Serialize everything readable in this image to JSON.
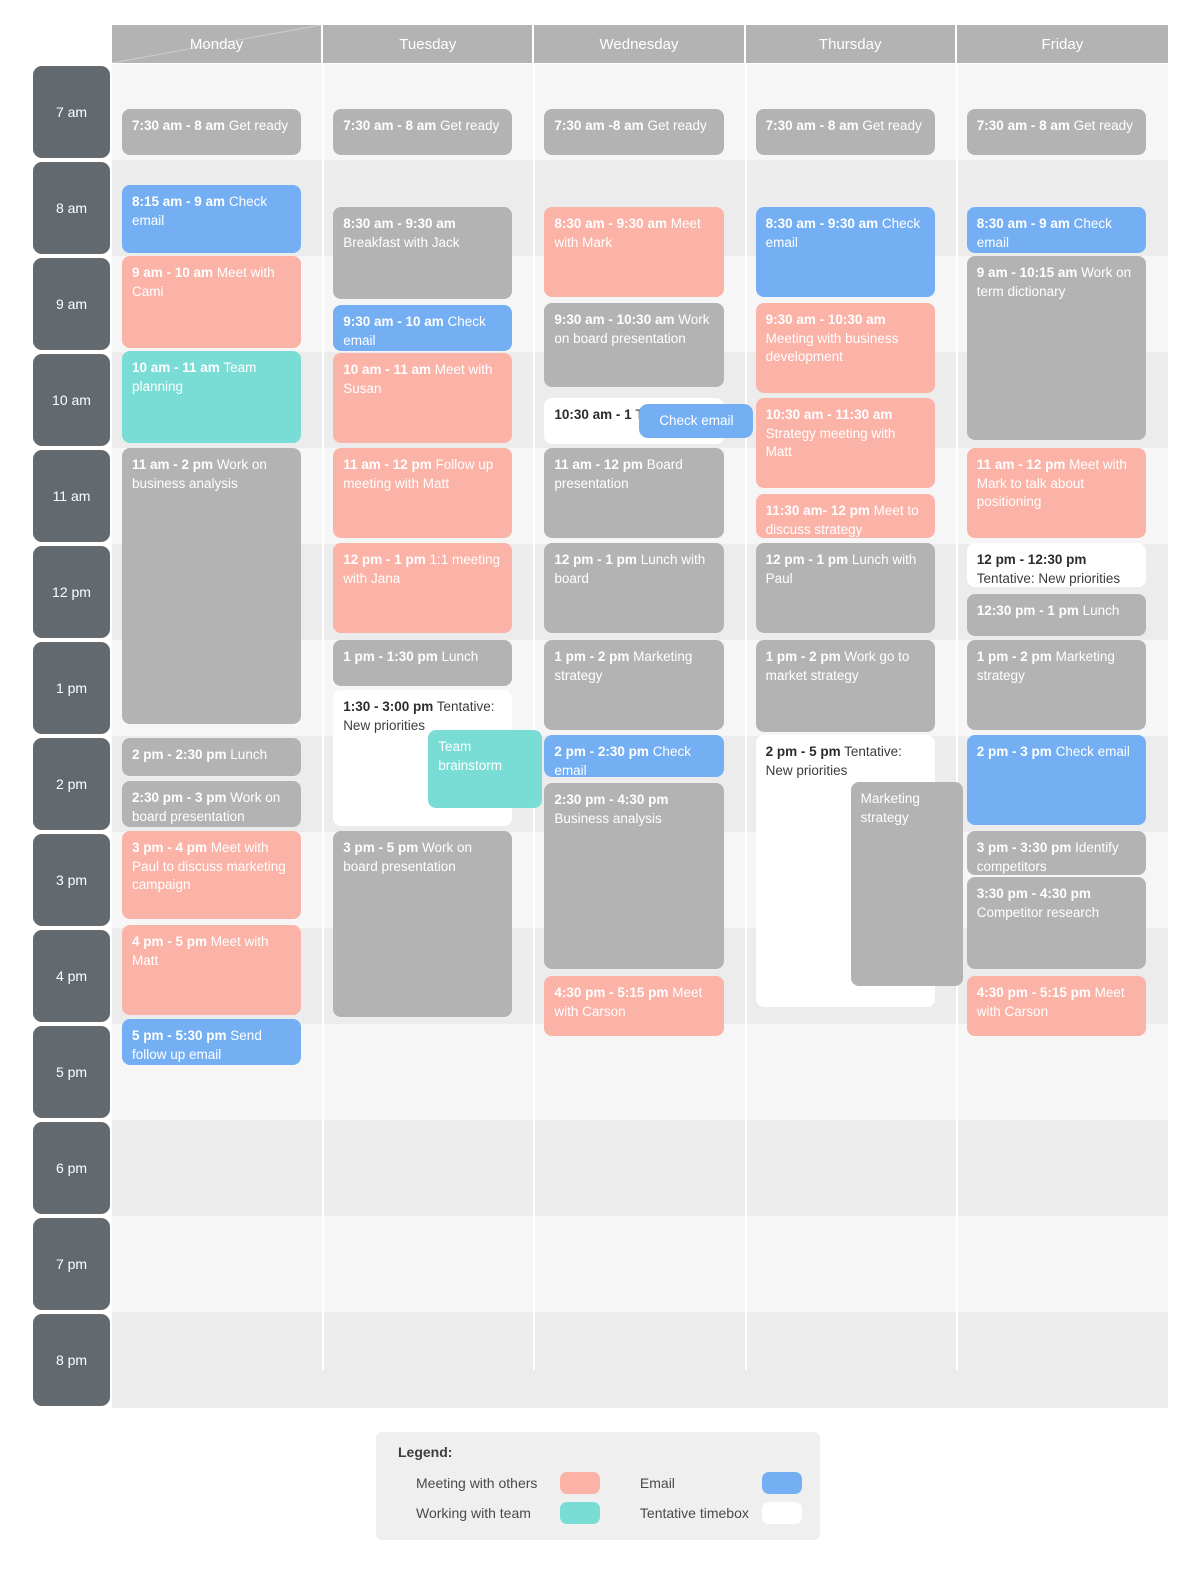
{
  "calendar": {
    "days": [
      "Monday",
      "Tuesday",
      "Wednesday",
      "Thursday",
      "Friday"
    ],
    "hours": [
      "7 am",
      "8 am",
      "9 am",
      "10 am",
      "11 am",
      "12 pm",
      "1 pm",
      "2 pm",
      "3 pm",
      "4 pm",
      "5 pm",
      "6 pm",
      "7 pm",
      "8 pm"
    ],
    "colors": {
      "meeting_with_others": "#fbb2a7",
      "working_with_team": "#79dcd5",
      "email": "#74aff4",
      "tentative_timebox": "#ffffff",
      "default_event": "#b3b3b3",
      "hour_gutter": "#62696f",
      "day_header": "#b3b3b3"
    },
    "events": [
      {
        "id": "mon-0730",
        "day": "Monday",
        "time": "7:30 am - 8 am",
        "title": "Get ready",
        "category": "default"
      },
      {
        "id": "mon-0815",
        "day": "Monday",
        "time": "8:15 am - 9 am",
        "title": "Check email",
        "category": "email"
      },
      {
        "id": "mon-0900",
        "day": "Monday",
        "time": "9 am - 10 am",
        "title": "Meet with Cami",
        "category": "meeting"
      },
      {
        "id": "mon-1000",
        "day": "Monday",
        "time": "10 am - 11 am",
        "title": "Team planning",
        "category": "team"
      },
      {
        "id": "mon-1100",
        "day": "Monday",
        "time": "11 am - 2 pm",
        "title": "Work on business analysis",
        "category": "default"
      },
      {
        "id": "mon-1400",
        "day": "Monday",
        "time": "2 pm - 2:30 pm",
        "title": "Lunch",
        "category": "default"
      },
      {
        "id": "mon-1430",
        "day": "Monday",
        "time": "2:30 pm - 3 pm",
        "title": "Work on board presentation",
        "category": "default"
      },
      {
        "id": "mon-1500",
        "day": "Monday",
        "time": "3 pm - 4 pm",
        "title": "Meet with Paul to discuss marketing campaign",
        "category": "meeting"
      },
      {
        "id": "mon-1600",
        "day": "Monday",
        "time": "4 pm - 5 pm",
        "title": "Meet with Matt",
        "category": "meeting"
      },
      {
        "id": "mon-1700",
        "day": "Monday",
        "time": "5 pm - 5:30 pm",
        "title": "Send follow up email",
        "category": "email"
      },
      {
        "id": "tue-0730",
        "day": "Tuesday",
        "time": "7:30 am - 8 am",
        "title": "Get ready",
        "category": "default"
      },
      {
        "id": "tue-0830",
        "day": "Tuesday",
        "time": "8:30 am - 9:30 am",
        "title": "Breakfast with Jack",
        "category": "default"
      },
      {
        "id": "tue-0930",
        "day": "Tuesday",
        "time": "9:30 am - 10 am",
        "title": "Check email",
        "category": "email"
      },
      {
        "id": "tue-1000",
        "day": "Tuesday",
        "time": "10 am - 11 am",
        "title": "Meet with Susan",
        "category": "meeting"
      },
      {
        "id": "tue-1100",
        "day": "Tuesday",
        "time": "11 am - 12 pm",
        "title": "Follow up meeting with Matt",
        "category": "meeting"
      },
      {
        "id": "tue-1200",
        "day": "Tuesday",
        "time": "12 pm - 1 pm",
        "title": "1:1 meeting with Jana",
        "category": "meeting"
      },
      {
        "id": "tue-1300",
        "day": "Tuesday",
        "time": "1 pm - 1:30 pm",
        "title": "Lunch",
        "category": "default"
      },
      {
        "id": "tue-1330",
        "day": "Tuesday",
        "time": "1:30 - 3:00 pm",
        "title": "Tentative: New priorities",
        "category": "tentative"
      },
      {
        "id": "tue-brainstorm",
        "day": "Tuesday",
        "time": "",
        "title": "Team brainstorm",
        "category": "team"
      },
      {
        "id": "tue-1500",
        "day": "Tuesday",
        "time": "3 pm - 5 pm",
        "title": "Work on board presentation",
        "category": "default"
      },
      {
        "id": "wed-0730",
        "day": "Wednesday",
        "time": "7:30 am -8 am",
        "title": "Get ready",
        "category": "default"
      },
      {
        "id": "wed-0830",
        "day": "Wednesday",
        "time": "8:30 am - 9:30 am",
        "title": "Meet with Mark",
        "category": "meeting"
      },
      {
        "id": "wed-0930",
        "day": "Wednesday",
        "time": "9:30 am - 10:30 am",
        "title": "Work on board presentation",
        "category": "default"
      },
      {
        "id": "wed-1030",
        "day": "Wednesday",
        "time": "10:30 am - 1",
        "title": "Tentative: N",
        "category": "tentative"
      },
      {
        "id": "wed-checkemail",
        "day": "Wednesday",
        "time": "",
        "title": "Check email",
        "category": "email"
      },
      {
        "id": "wed-1100",
        "day": "Wednesday",
        "time": "11 am - 12 pm",
        "title": "Board presentation",
        "category": "default"
      },
      {
        "id": "wed-1200",
        "day": "Wednesday",
        "time": "12 pm - 1 pm",
        "title": "Lunch with board",
        "category": "default"
      },
      {
        "id": "wed-1300",
        "day": "Wednesday",
        "time": "1 pm - 2 pm",
        "title": "Marketing strategy",
        "category": "default"
      },
      {
        "id": "wed-1400",
        "day": "Wednesday",
        "time": "2 pm - 2:30 pm",
        "title": "Check email",
        "category": "email"
      },
      {
        "id": "wed-1430",
        "day": "Wednesday",
        "time": "2:30 pm - 4:30 pm",
        "title": "Business analysis",
        "category": "default"
      },
      {
        "id": "wed-1630",
        "day": "Wednesday",
        "time": "4:30 pm - 5:15 pm",
        "title": "Meet with Carson",
        "category": "meeting"
      },
      {
        "id": "thu-0730",
        "day": "Thursday",
        "time": "7:30 am - 8 am",
        "title": "Get ready",
        "category": "default"
      },
      {
        "id": "thu-0830",
        "day": "Thursday",
        "time": "8:30 am - 9:30 am",
        "title": "Check email",
        "category": "email"
      },
      {
        "id": "thu-0930",
        "day": "Thursday",
        "time": "9:30 am  - 10:30 am",
        "title": "Meeting with business development",
        "category": "meeting"
      },
      {
        "id": "thu-1030",
        "day": "Thursday",
        "time": "10:30 am - 11:30 am",
        "title": "Strategy meeting with Matt",
        "category": "meeting"
      },
      {
        "id": "thu-1130",
        "day": "Thursday",
        "time": "11:30 am- 12 pm",
        "title": "Meet to discuss strategy",
        "category": "meeting"
      },
      {
        "id": "thu-1200",
        "day": "Thursday",
        "time": "12 pm - 1 pm",
        "title": "Lunch with Paul",
        "category": "default"
      },
      {
        "id": "thu-1300",
        "day": "Thursday",
        "time": "1 pm - 2 pm",
        "title": "Work go to market strategy",
        "category": "default"
      },
      {
        "id": "thu-1400",
        "day": "Thursday",
        "time": "2 pm  - 5 pm",
        "title": "Tentative: New priorities",
        "category": "tentative"
      },
      {
        "id": "thu-marketing",
        "day": "Thursday",
        "time": "",
        "title": "Marketing strategy",
        "category": "default"
      },
      {
        "id": "fri-0730",
        "day": "Friday",
        "time": "7:30 am - 8 am",
        "title": "Get ready",
        "category": "default"
      },
      {
        "id": "fri-0830",
        "day": "Friday",
        "time": "8:30 am - 9 am",
        "title": "Check email",
        "category": "email"
      },
      {
        "id": "fri-0900",
        "day": "Friday",
        "time": "9 am - 10:15 am",
        "title": "Work on term dictionary",
        "category": "default"
      },
      {
        "id": "fri-1100",
        "day": "Friday",
        "time": "11 am - 12 pm",
        "title": "Meet with Mark to talk about positioning",
        "category": "meeting"
      },
      {
        "id": "fri-1200",
        "day": "Friday",
        "time": "12 pm - 12:30 pm",
        "title": "Tentative: New priorities",
        "category": "tentative"
      },
      {
        "id": "fri-1230",
        "day": "Friday",
        "time": "12:30 pm - 1 pm",
        "title": "Lunch",
        "category": "default"
      },
      {
        "id": "fri-1300",
        "day": "Friday",
        "time": "1 pm - 2 pm",
        "title": "Marketing strategy",
        "category": "default"
      },
      {
        "id": "fri-1400",
        "day": "Friday",
        "time": "2 pm - 3 pm",
        "title": "Check email",
        "category": "email"
      },
      {
        "id": "fri-1500",
        "day": "Friday",
        "time": "3 pm - 3:30 pm",
        "title": "Identify competitors",
        "category": "default"
      },
      {
        "id": "fri-1530",
        "day": "Friday",
        "time": "3:30 pm - 4:30 pm",
        "title": "Competitor research",
        "category": "default"
      },
      {
        "id": "fri-1630",
        "day": "Friday",
        "time": "4:30 pm - 5:15 pm",
        "title": "Meet with Carson",
        "category": "meeting"
      }
    ]
  },
  "legend": {
    "title": "Legend:",
    "items": [
      {
        "label": "Meeting with others",
        "color": "#fbb2a7"
      },
      {
        "label": "Email",
        "color": "#74aff4"
      },
      {
        "label": "Working with team",
        "color": "#79dcd5"
      },
      {
        "label": "Tentative timebox",
        "color": "#ffffff"
      }
    ]
  }
}
